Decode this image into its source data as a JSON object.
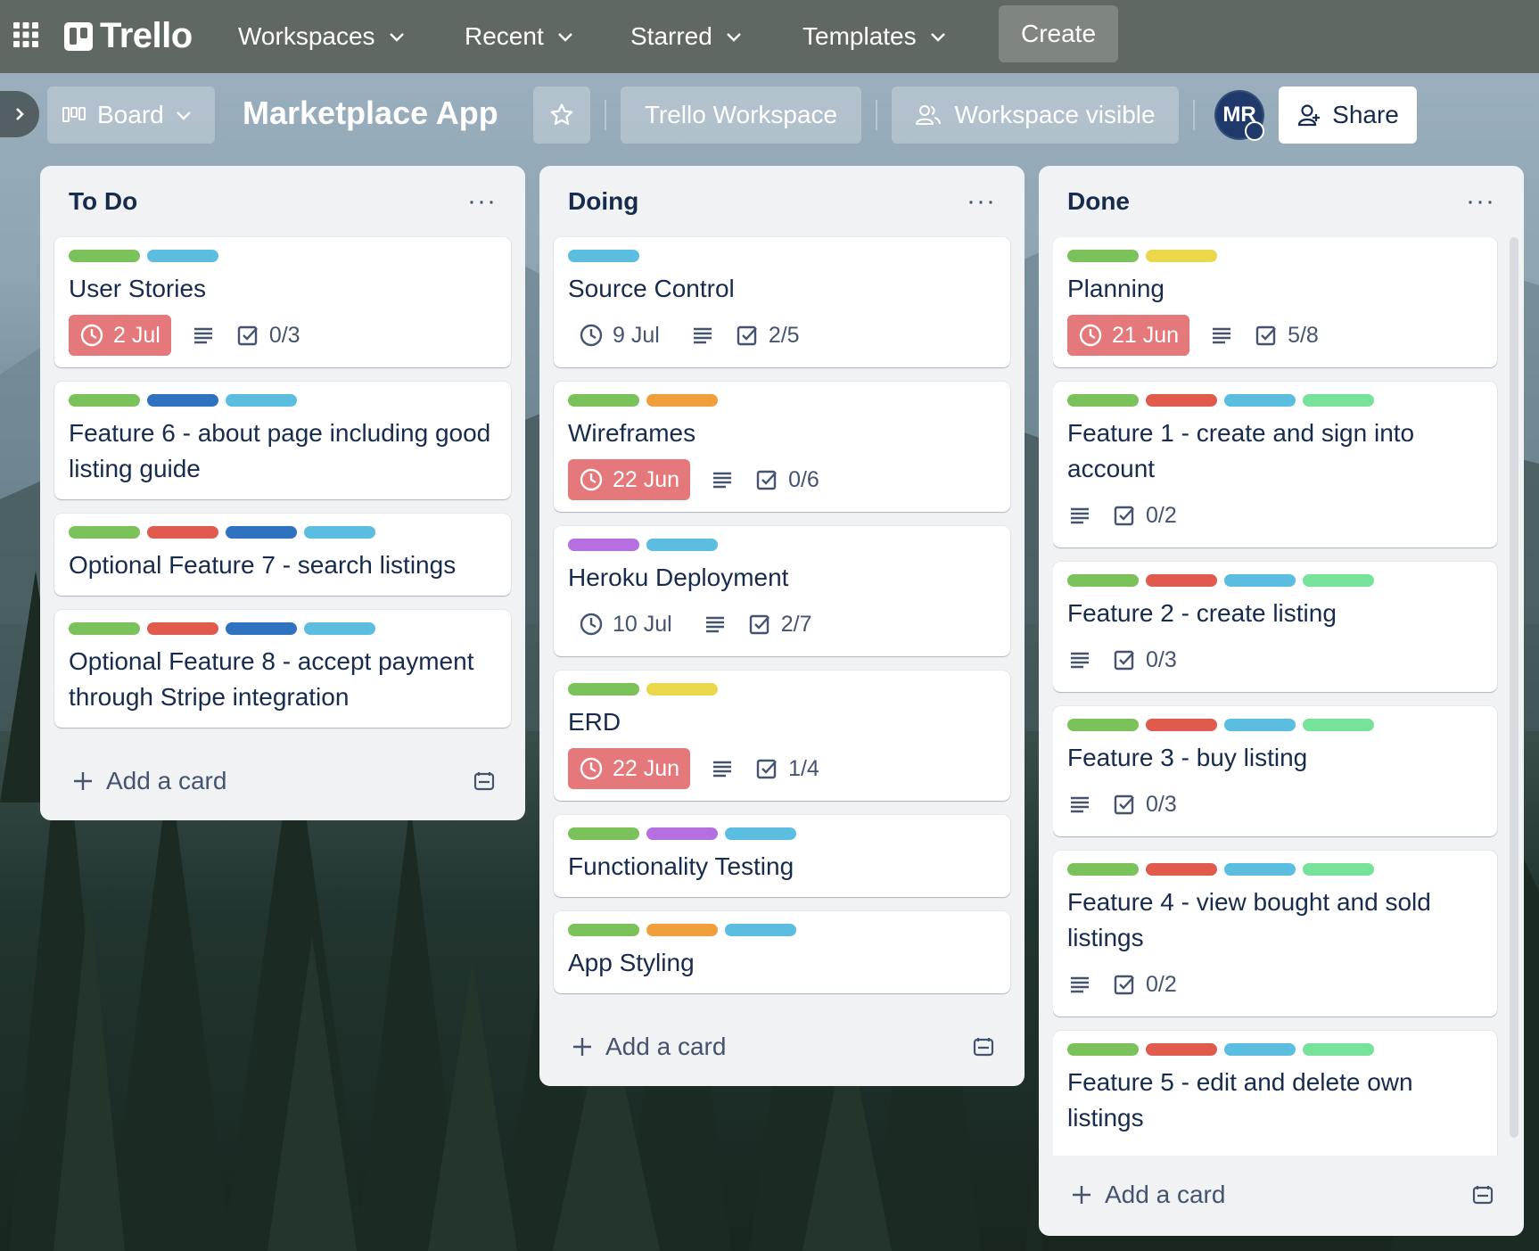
{
  "nav": {
    "logo": "Trello",
    "menus": [
      {
        "label": "Workspaces"
      },
      {
        "label": "Recent"
      },
      {
        "label": "Starred"
      },
      {
        "label": "Templates"
      }
    ],
    "create_label": "Create"
  },
  "board": {
    "view_label": "Board",
    "title": "Marketplace App",
    "workspace_label": "Trello Workspace",
    "visibility_label": "Workspace visible",
    "avatar_initials": "MR",
    "share_label": "Share"
  },
  "label_colors": {
    "green": "#7bc25a",
    "sky": "#5bbde0",
    "blue": "#2f72c0",
    "red": "#e05a4e",
    "yellow": "#ead84a",
    "orange": "#f19f3c",
    "purple": "#b56fe0",
    "lime": "#76e29a"
  },
  "lists": [
    {
      "title": "To Do",
      "add_label": "Add a card",
      "cards": [
        {
          "title": "User Stories",
          "labels": [
            "green",
            "sky"
          ],
          "due": "2 Jul",
          "due_overdue": true,
          "description": true,
          "checklist": "0/3"
        },
        {
          "title": "Feature 6 - about page including good listing guide",
          "labels": [
            "green",
            "blue",
            "sky"
          ]
        },
        {
          "title": "Optional Feature 7 - search listings",
          "labels": [
            "green",
            "red",
            "blue",
            "sky"
          ]
        },
        {
          "title": "Optional Feature 8 - accept payment through Stripe integration",
          "labels": [
            "green",
            "red",
            "blue",
            "sky"
          ]
        }
      ]
    },
    {
      "title": "Doing",
      "add_label": "Add a card",
      "cards": [
        {
          "title": "Source Control",
          "labels": [
            "sky"
          ],
          "due": "9 Jul",
          "due_overdue": false,
          "description": true,
          "checklist": "2/5"
        },
        {
          "title": "Wireframes",
          "labels": [
            "green",
            "orange"
          ],
          "due": "22 Jun",
          "due_overdue": true,
          "description": true,
          "checklist": "0/6"
        },
        {
          "title": "Heroku Deployment",
          "labels": [
            "purple",
            "sky"
          ],
          "due": "10 Jul",
          "due_overdue": false,
          "description": true,
          "checklist": "2/7"
        },
        {
          "title": "ERD",
          "labels": [
            "green",
            "yellow"
          ],
          "due": "22 Jun",
          "due_overdue": true,
          "description": true,
          "checklist": "1/4"
        },
        {
          "title": "Functionality Testing",
          "labels": [
            "green",
            "purple",
            "sky"
          ]
        },
        {
          "title": "App Styling",
          "labels": [
            "green",
            "orange",
            "sky"
          ]
        }
      ]
    },
    {
      "title": "Done",
      "add_label": "Add a card",
      "cards": [
        {
          "title": "Planning",
          "labels": [
            "green",
            "yellow"
          ],
          "due": "21 Jun",
          "due_overdue": true,
          "description": true,
          "checklist": "5/8"
        },
        {
          "title": "Feature 1 - create and sign into account",
          "labels": [
            "green",
            "red",
            "sky",
            "lime"
          ],
          "description": true,
          "checklist": "0/2"
        },
        {
          "title": "Feature 2 - create listing",
          "labels": [
            "green",
            "red",
            "sky",
            "lime"
          ],
          "description": true,
          "checklist": "0/3"
        },
        {
          "title": "Feature 3 - buy listing",
          "labels": [
            "green",
            "red",
            "sky",
            "lime"
          ],
          "description": true,
          "checklist": "0/3"
        },
        {
          "title": "Feature 4 - view bought and sold listings",
          "labels": [
            "green",
            "red",
            "sky",
            "lime"
          ],
          "description": true,
          "checklist": "0/2"
        },
        {
          "title": "Feature 5 - edit and delete own listings",
          "labels": [
            "green",
            "red",
            "sky",
            "lime"
          ],
          "description": true
        }
      ]
    }
  ]
}
